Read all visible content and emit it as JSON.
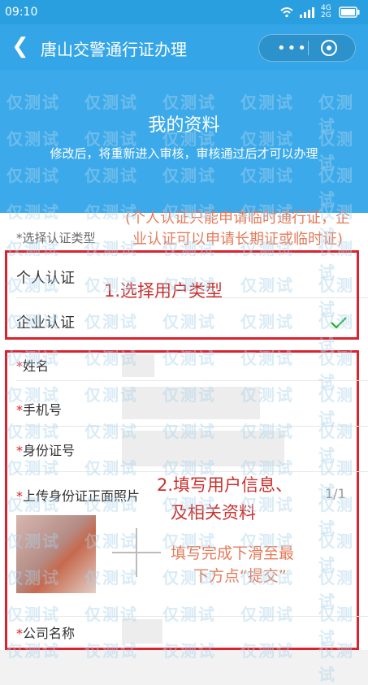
{
  "status_bar": {
    "time": "09:10",
    "network": "4G 2G",
    "battery_icon": "battery-icon",
    "wifi_icon": "wifi-icon"
  },
  "nav": {
    "back_icon": "chevron-left-icon",
    "title": "唐山交警通行证办理",
    "more_icon": "more-dots-icon",
    "close_icon": "target-icon"
  },
  "hero": {
    "title": "我的资料",
    "subtitle": "修改后，将重新进入审核，审核通过后才可以办理"
  },
  "form": {
    "cert_type_label": "*选择认证类型",
    "cert_options": [
      {
        "label": "个人认证",
        "selected": false
      },
      {
        "label": "企业认证",
        "selected": true
      }
    ],
    "fields": {
      "name": "姓名",
      "phone": "手机号",
      "id_number": "身份证号",
      "id_photo": "上传身份证正面照片",
      "photo_count": "1/1",
      "company": "公司名称"
    }
  },
  "annotations": {
    "note1": "(个人认证只能申请临时通行证，企业认证可以申请长期证或临时证)",
    "step1": "1.选择用户类型",
    "step2_line1": "2.填写用户信息、",
    "step2_line2": "及相关资料",
    "step2_note_line1": "填写完成下滑至最",
    "step2_note_line2": "下方点“提交”"
  },
  "watermark": "仅测试",
  "colors": {
    "header": "#34a6e8",
    "accent_red": "#d9232e",
    "check_green": "#19ad19"
  }
}
